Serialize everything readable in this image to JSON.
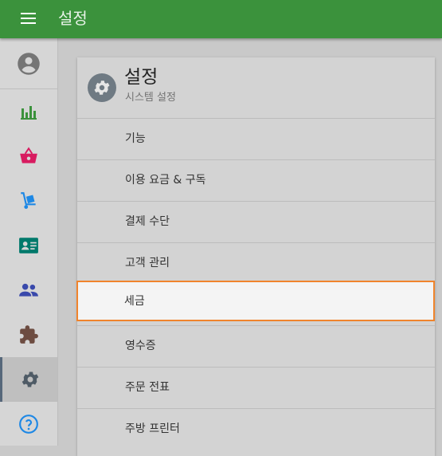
{
  "topbar": {
    "title": "설정",
    "menu_icon": "menu-icon"
  },
  "sidebar": {
    "items": [
      {
        "name": "account",
        "icon": "account-circle-icon",
        "color": "#6f6f6f"
      },
      {
        "name": "reports",
        "icon": "bar-chart-icon",
        "color": "#3b923c"
      },
      {
        "name": "sales",
        "icon": "basket-icon",
        "color": "#d81b60"
      },
      {
        "name": "inventory",
        "icon": "hand-truck-icon",
        "color": "#1e88e5"
      },
      {
        "name": "employees",
        "icon": "id-card-icon",
        "color": "#00796b"
      },
      {
        "name": "customers",
        "icon": "people-icon",
        "color": "#3949ab"
      },
      {
        "name": "integrations",
        "icon": "puzzle-icon",
        "color": "#6d4c41"
      },
      {
        "name": "settings",
        "icon": "gear-icon",
        "color": "#4f5b66",
        "active": true
      },
      {
        "name": "help",
        "icon": "help-icon",
        "color": "#1e88e5"
      }
    ]
  },
  "card": {
    "title": "설정",
    "subtitle": "시스템 설정",
    "header_icon": "gear-icon",
    "menu": [
      {
        "label": "기능"
      },
      {
        "label": "이용 요금 & 구독"
      },
      {
        "label": "결제 수단"
      },
      {
        "label": "고객 관리"
      },
      {
        "label": "세금",
        "selected": true
      },
      {
        "label": "영수증"
      },
      {
        "label": "주문 전표"
      },
      {
        "label": "주방 프린터"
      }
    ]
  },
  "colors": {
    "topbar": "#3b923c",
    "selection_outline": "#f0842c"
  }
}
